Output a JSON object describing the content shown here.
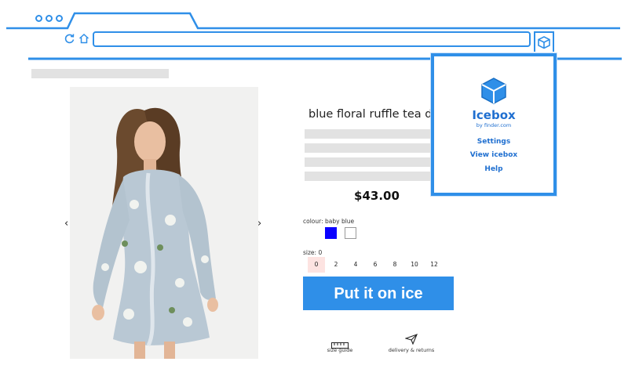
{
  "browser": {
    "icons": [
      "reload-icon",
      "home-icon",
      "cube-icon"
    ],
    "address_value": ""
  },
  "product": {
    "title": "blue floral ruffle tea dress",
    "price": "$43.00",
    "colour_label": "colour: baby blue",
    "colours": [
      "#0a00ff",
      "#ffffff"
    ],
    "size_label": "size: 0",
    "sizes": [
      "0",
      "2",
      "4",
      "6",
      "8",
      "10",
      "12"
    ],
    "selected_size": "0",
    "cta": "Put it on ice",
    "links": {
      "size_guide": "size guide",
      "delivery": "delivery & returns"
    }
  },
  "popup": {
    "brand": "Icebox",
    "byline": "by finder.com",
    "menu": [
      "Settings",
      "View icebox",
      "Help"
    ]
  },
  "colors": {
    "accent": "#2f8fe8",
    "selected_size_bg": "#fde3e1"
  }
}
